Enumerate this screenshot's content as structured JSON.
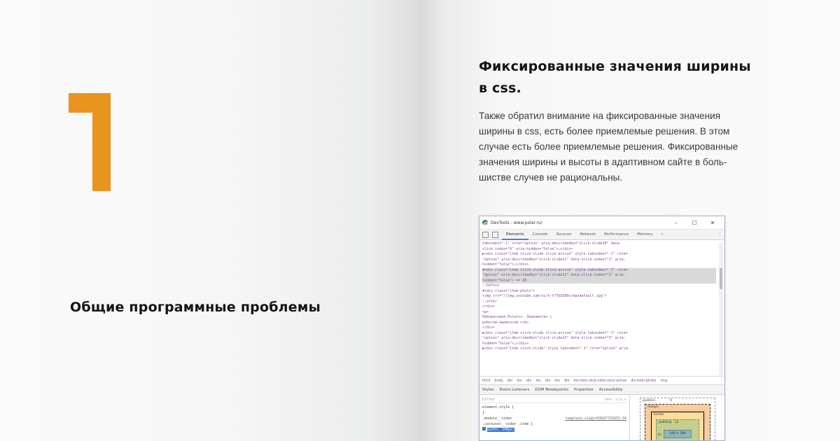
{
  "colors": {
    "accent": "#e8941f",
    "heading": "#141414",
    "body": "#3a3a3a"
  },
  "left_page": {
    "big_number": "1",
    "heading": "Общие программные проблемы"
  },
  "right_page": {
    "heading_line1": "Фиксированные значения ширины",
    "heading_line2": "в css.",
    "body_lines": [
      "Также обратил внимание на  фиксированные значения",
      "ширины в css, есть более приемлемые решения. В этом",
      "случае есть более приемлемые решения. Фиксированные",
      "значения ширины  и высоты в адаптивном сайте в боль-",
      "шистве случев не рациональны."
    ]
  },
  "devtools": {
    "window_title": "DevTools - www.polar.ru/",
    "window_buttons": [
      "–",
      "☐",
      "✕"
    ],
    "tabs": [
      "Elements",
      "Console",
      "Sources",
      "Network",
      "Performance",
      "Memory",
      "»"
    ],
    "code_lines": [
      "tabindex=\"-1\" role=\"option\" aria-describedby=\"slick-slide10\" data-",
      "slick-index=\"0\" aria-hidden=\"false\">…</div>",
      "▶<div class=\"item slick-slide slick-active\" style tabindex=\"-1\" role=",
      "\"option\" aria-describedby=\"slick-slide11\" data-slick-index=\"1\" aria-",
      "hidden=\"false\">…</div>",
      "▼<div class=\"item slick-slide slick-active\" style tabindex=\"-1\" role=",
      "\"option\" aria-describedby=\"slick-slide12\" data-slick-index=\"2\" aria-",
      "hidden=\"false\"> == $0",
      "  ::before",
      "  ▼<div class=\"item-photo\">",
      "     <img src=\"//img.youtube.com/vi/h-t77bID9Ds/maxdefault.jpg\">",
      "     ::after",
      "   </div>",
      "   <p>",
      "                              Лаборатория Polaris: Знакомство с",
      "     роботом-пылесосом                               </p>",
      "  </div>",
      "▶<div class=\"item slick-slide slick-active\" style tabindex=\"-1\" role=",
      "\"option\" aria-describedby=\"slick-slide13\" data-slick-index=\"3\" aria-",
      "hidden=\"false\">…</div>",
      "▶<div class=\"item slick-slide\" style tabindex=\"-1\" role=\"option\" aria-"
    ],
    "breadcrumbs": [
      "html",
      "body",
      "div",
      "div",
      "div",
      "div",
      "div",
      "div",
      "div",
      "div.item.slick-slide.slick-active",
      "div.item-photo",
      "img"
    ],
    "subtabs": [
      "Styles",
      "Event Listeners",
      "DOM Breakpoints",
      "Properties",
      "Accessibility"
    ],
    "styles": {
      "filter_placeholder": "Filter",
      "filter_right": ":hov  .cls  +",
      "lines": [
        "element.style {",
        "}",
        ".module__video",
        ".carousel__video .item {"
      ],
      "link": "template.css@i=03697733955:34",
      "highlight": "width: 240px;"
    },
    "box_model": {
      "position_label": "position",
      "position_value": "0",
      "margin_label": "margin",
      "margin_value": "–",
      "border_label": "border",
      "border_value": "–",
      "padding_label": "padding",
      "padding_value": "12",
      "content_value": "240 × 180",
      "side_value": "12"
    }
  }
}
